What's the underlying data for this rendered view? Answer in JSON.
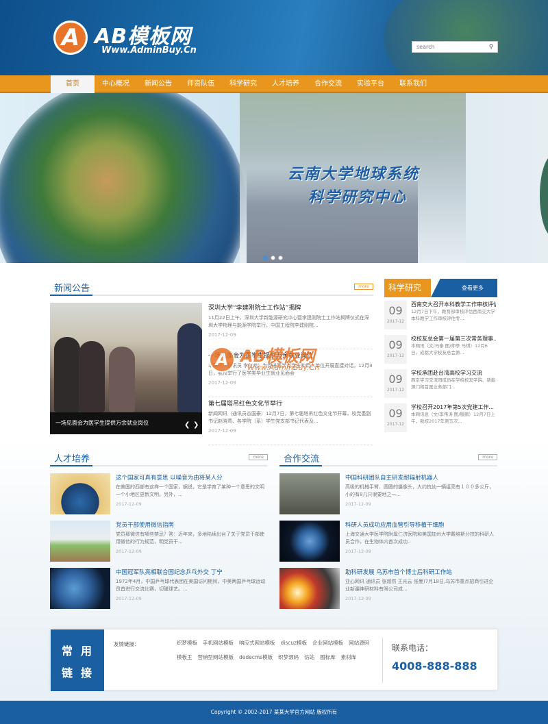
{
  "brand": {
    "logo_letter": "A",
    "name": "AB模板网",
    "url": "Www.AdminBuy.Cn"
  },
  "search": {
    "placeholder": "search",
    "icon": "search-icon"
  },
  "nav": {
    "items": [
      "首页",
      "中心概况",
      "新闻公告",
      "师资队伍",
      "科学研究",
      "人才培养",
      "合作交流",
      "实验平台",
      "联系我们"
    ],
    "active": "首页"
  },
  "banner": {
    "caption_line1": "云南大学地球系统",
    "caption_line2": "科学研究中心",
    "slides": 3,
    "active_slide": 1
  },
  "news": {
    "title": "新闻公告",
    "more": "more",
    "photo_caption": "一场见面会为医学生提供万余就业岗位",
    "items": [
      {
        "title": "深圳大学“李建刚院士工作站”揭牌",
        "desc": "11月22日上午，深圳大学新能源研究中心暨李建刚院士工作站揭牌仪式在深圳大学物理与能源学院举行。中国工程院李建刚院...",
        "date": "2017-12-09"
      },
      {
        "title": "一场见面会为医学生提供万余就业岗位",
        "desc": "本网讯（通讯员 李仁龙）为促进医学类学生和用人单位开展直接对话，12月3日，我校举行了医学类毕业生就业见面会",
        "date": "2017-12-09"
      },
      {
        "title": "第七届塔吊红色文化节举行",
        "desc": "新闻网讯（通讯员谷国豪）12月7日，第七届塔吊红色文化节开幕，校党委副书记赵晓莺、各学院（系）学生党支部书记代表及...",
        "date": "2017-12-09"
      }
    ]
  },
  "science": {
    "title": "科学研究",
    "more": "查看更多",
    "items": [
      {
        "day": "09",
        "month": "2017-12",
        "title": "西南交大召开本科教学工作审核评估专家...",
        "desc": "12月7日下午，教育部审核评估西南交大学本科教学工作审核评估专..."
      },
      {
        "day": "09",
        "month": "2017-12",
        "title": "校校友总会第一届第三次常务理事...",
        "desc": "本网讯（文/马泰 图/师李 马琪）12月6日，成都大学校友总会第..."
      },
      {
        "day": "09",
        "month": "2017-12",
        "title": "学校承团赴台湾高校学习交流",
        "desc": "西京学习交流团成员在学校校友学院、新能源门和首属业务部门..."
      },
      {
        "day": "09",
        "month": "2017-12",
        "title": "学校召开2017年第5次党建工作...",
        "desc": "本网讯息（文/李伟涛 图/殷鹏）12月7日上午，我校2017年第五次..."
      }
    ]
  },
  "talent": {
    "title": "人才培养",
    "more": "more",
    "items": [
      {
        "title": "这个国家可真有意思 以噪音为由将某人分",
        "desc": "在美国的西部有这样一个国家，据说，它是学育了某种一个意思的文明一个小地区更新文明。另外，...",
        "date": "2017-12-09"
      },
      {
        "title": "党员干部使用微信指南",
        "desc": "党员那微信有哪些禁忌？答：近年来，多地陆续出台了关于党员干部使用微信的行为规范，明党员干...",
        "date": "2017-12-09"
      },
      {
        "title": "中国冠军队亮相联合国纪念乒乓外交 丁宁",
        "desc": "1972年4月，中国乒乓球代表团在美国访问期间，中美两国乒乓球运动员首进行交流比赛，切磋球艺。...",
        "date": "2017-12-09"
      }
    ]
  },
  "coop": {
    "title": "合作交流",
    "more": "more",
    "items": [
      {
        "title": "中国科研团队自主研发耐辐射机器人",
        "desc": "高吸的机械手臂、圆圆的摄像头，大约抗幼一辆组亮有１００多公斤，小的有8几只很要地之一...",
        "date": "2017-12-09"
      },
      {
        "title": "科研人员成功应用血管引导移植干细胞",
        "desc": "上海交通大学医学院附属仁济医院和美国加州大学戴维斯分校的科研人员合作，在生物体内首次成功..",
        "date": "2017-12-09"
      },
      {
        "title": "助科研发展 乌苏市首个博士后科研工作站",
        "desc": "亚心网讯 通讯员 张超然 王光云 张曼)7月18日,乌苏市重点招商引进企业新疆神研材料有限公司成...",
        "date": "2017-12-09"
      }
    ]
  },
  "links": {
    "badge": [
      "常",
      "用",
      "链",
      "接"
    ],
    "label": "友情链接：",
    "items": [
      "织梦模板",
      "手机网站模板",
      "响应式网站模板",
      "discuz模板",
      "企业网站模板",
      "网站源码",
      "模板王",
      "营销型网站模板",
      "dedecms模板",
      "织梦源码",
      "仿站",
      "图标库",
      "素材库"
    ],
    "phone_label": "联系电话：",
    "phone": "4008-888-888"
  },
  "watermark": {
    "letter": "A",
    "name": "AB模板网",
    "url": "Www.AdminBuy.Cn"
  },
  "footer": {
    "text": "Copyright © 2002-2017 某某大学官方网站 版权所有"
  }
}
